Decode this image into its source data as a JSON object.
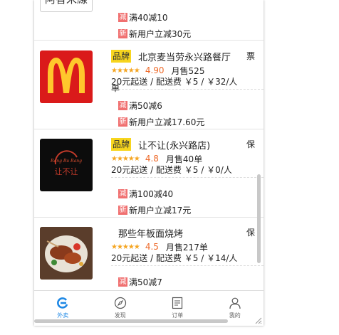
{
  "shops": [
    {
      "id": "top",
      "name": "阿香米線",
      "promos": [
        {
          "icon": "减",
          "text": "满40减10"
        },
        {
          "icon": "新",
          "text": "新用户立减30元"
        }
      ]
    },
    {
      "id": "mcd",
      "badge": "品牌",
      "name": "北京麦当劳永兴路餐厅",
      "tag": "票",
      "stars": "★★★★★",
      "score": "4.90",
      "sales": "月售525",
      "delivery": "20元起送 / 配送费 ￥5 / ￥32/人",
      "delivery_wrap": "单",
      "promos": [
        {
          "icon": "减",
          "text": "满50减6"
        },
        {
          "icon": "新",
          "text": "新用户立减17.60元"
        }
      ]
    },
    {
      "id": "rbr",
      "badge": "品牌",
      "name": "让不让(永兴路店)",
      "tag": "保",
      "stars": "★★★★★",
      "score": "4.8",
      "sales": "月售40单",
      "delivery": "20元起送 / 配送费 ￥5 / ￥0/人",
      "logo_text_top": "Rang Bu Rang",
      "logo_text_bottom": "让不让",
      "promos": [
        {
          "icon": "减",
          "text": "满100减40"
        },
        {
          "icon": "新",
          "text": "新用户立减17元"
        }
      ]
    },
    {
      "id": "nxn",
      "name": "那些年板面烧烤",
      "tag": "保",
      "stars": "★★★★★",
      "score": "4.5",
      "sales": "月售217单",
      "delivery": "20元起送 / 配送费 ￥5 / ￥14/人",
      "promos": [
        {
          "icon": "减",
          "text": "满50减7"
        }
      ]
    }
  ],
  "tabbar": [
    {
      "label": "外卖",
      "icon": "waimai-icon",
      "active": true
    },
    {
      "label": "发现",
      "icon": "compass-icon",
      "active": false
    },
    {
      "label": "订单",
      "icon": "order-icon",
      "active": false
    },
    {
      "label": "我的",
      "icon": "user-icon",
      "active": false
    }
  ],
  "colors": {
    "accent": "#1e88e5",
    "brand_badge": "#f7d51e",
    "score": "#ee6a2a",
    "promo_icon": "#f07070",
    "mcd_red": "#da1a1a",
    "mcd_yellow": "#ffc72c"
  }
}
